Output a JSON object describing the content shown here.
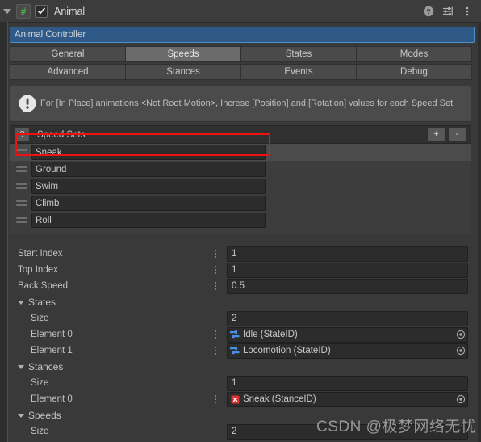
{
  "titlebar": {
    "object_name": "Animal",
    "script_icon": "#",
    "enabled_checkbox": true,
    "help_icon": "help-icon",
    "preset_icon": "preset-icon",
    "menu_icon": "kebab-menu-icon"
  },
  "controller_field": {
    "value": "Animal Controller"
  },
  "tabs": {
    "row1": [
      {
        "label": "General",
        "selected": false
      },
      {
        "label": "Speeds",
        "selected": true
      },
      {
        "label": "States",
        "selected": false
      },
      {
        "label": "Modes",
        "selected": false
      }
    ],
    "row2": [
      {
        "label": "Advanced",
        "selected": false
      },
      {
        "label": "Stances",
        "selected": false
      },
      {
        "label": "Events",
        "selected": false
      },
      {
        "label": "Debug",
        "selected": false
      }
    ]
  },
  "helpbox": {
    "icon": "info-bubble-icon",
    "message": "For [In Place] animations <Not Root Motion>, Increse [Position] and [Rotation] values for each Speed Set"
  },
  "speed_sets": {
    "help_button": "?",
    "title": "Speed Sets",
    "add_button": "+",
    "remove_button": "-",
    "items": [
      {
        "name": "Sneak",
        "selected": true
      },
      {
        "name": "Ground",
        "selected": false
      },
      {
        "name": "Swim",
        "selected": false
      },
      {
        "name": "Climb",
        "selected": false
      },
      {
        "name": "Roll",
        "selected": false
      }
    ]
  },
  "annotation": {
    "color": "#ee1111",
    "target": "Sneak"
  },
  "properties": [
    {
      "label": "Start Index",
      "value": "1",
      "override": true
    },
    {
      "label": "Top Index",
      "value": "1",
      "override": true
    },
    {
      "label": "Back Speed",
      "value": "0.5",
      "override": true
    }
  ],
  "sections": [
    {
      "name": "States",
      "expanded": true,
      "size_label": "Size",
      "size_value": "2",
      "elements": [
        {
          "label": "Element 0",
          "value": "Idle (StateID)",
          "icon": "stateid-icon",
          "icon_color": "#4a90e2",
          "override": true
        },
        {
          "label": "Element 1",
          "value": "Locomotion (StateID)",
          "icon": "stateid-icon",
          "icon_color": "#4a90e2",
          "override": true
        }
      ]
    },
    {
      "name": "Stances",
      "expanded": true,
      "size_label": "Size",
      "size_value": "1",
      "elements": [
        {
          "label": "Element 0",
          "value": "Sneak (StanceID)",
          "icon": "stanceid-icon",
          "icon_color": "#e03232",
          "override": true
        }
      ]
    },
    {
      "name": "Speeds",
      "expanded": true,
      "size_label": "Size",
      "size_value": "2",
      "elements": []
    }
  ],
  "watermark": "CSDN @极梦网络无忧"
}
